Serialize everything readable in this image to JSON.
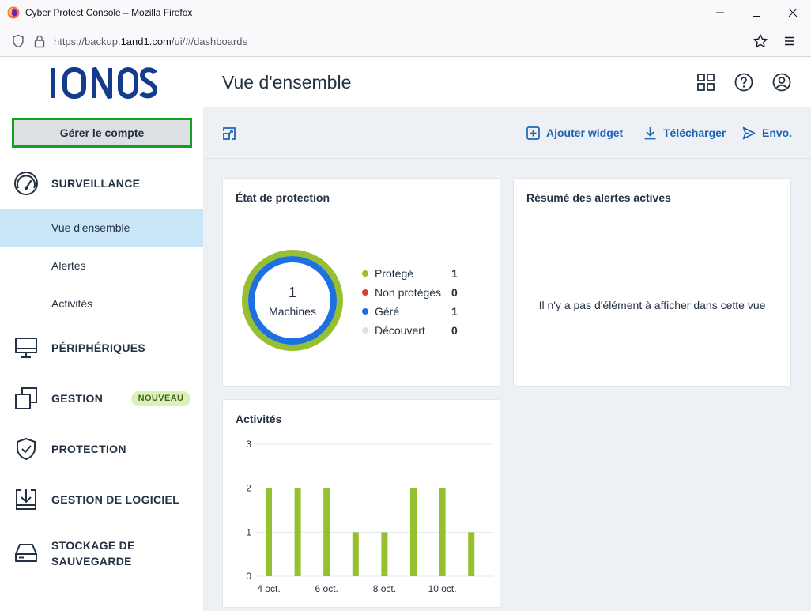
{
  "browser": {
    "window_title": "Cyber Protect Console – Mozilla Firefox",
    "url_prefix": "https://backup.",
    "url_domain": "1and1.com",
    "url_suffix": "/ui/#/dashboards"
  },
  "sidebar": {
    "logo_text": "IONOS",
    "account_button": "Gérer le compte",
    "sections": {
      "surveillance": "SURVEILLANCE",
      "peripheriques": "PÉRIPHÉRIQUES",
      "gestion": "GESTION",
      "gestion_badge": "NOUVEAU",
      "protection": "PROTECTION",
      "gestion_logiciel": "GESTION DE LOGICIEL",
      "stockage_line1": "STOCKAGE DE",
      "stockage_line2": "SAUVEGARDE"
    },
    "sub_items": {
      "overview": "Vue d'ensemble",
      "alerts": "Alertes",
      "activities": "Activités"
    }
  },
  "header": {
    "title": "Vue d'ensemble"
  },
  "toolbar": {
    "add_widget": "Ajouter widget",
    "download": "Télécharger",
    "send": "Envo."
  },
  "protection_card": {
    "title": "État de protection",
    "total": "1",
    "total_label": "Machines",
    "legend": [
      {
        "label": "Protégé",
        "value": "1",
        "color": "#96c02f"
      },
      {
        "label": "Non protégés",
        "value": "0",
        "color": "#e53935"
      },
      {
        "label": "Géré",
        "value": "1",
        "color": "#1e6fe0"
      },
      {
        "label": "Découvert",
        "value": "0",
        "color": "#d8e3ef"
      }
    ]
  },
  "alerts_card": {
    "title": "Résumé des alertes actives",
    "empty_message": "Il n'y a pas d'élément à afficher dans cette vue"
  },
  "activities_card": {
    "title": "Activités"
  },
  "chart_data": {
    "type": "bar",
    "title": "Activités",
    "categories": [
      "4 oct.",
      "5 oct.",
      "6 oct.",
      "7 oct.",
      "8 oct.",
      "9 oct.",
      "10 oct.",
      "11 oct."
    ],
    "tick_labels_x": [
      "4 oct.",
      "6 oct.",
      "8 oct.",
      "10 oct."
    ],
    "values": [
      2,
      2,
      2,
      1,
      1,
      2,
      2,
      1
    ],
    "ylim": [
      0,
      3
    ],
    "yticks": [
      0,
      1,
      2,
      3
    ],
    "grid": true,
    "bar_color": "#96c02f"
  }
}
